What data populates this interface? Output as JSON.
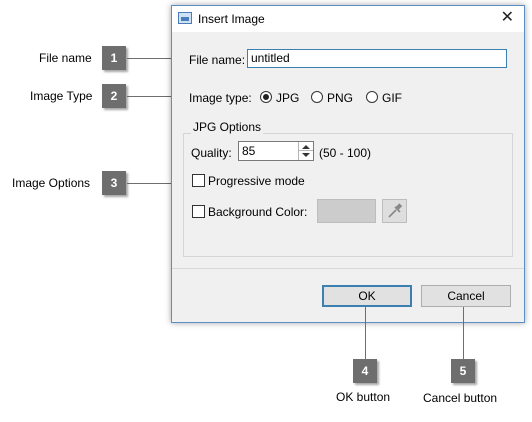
{
  "dialog": {
    "title": "Insert Image",
    "file_name_label": "File name:",
    "file_name_value": "untitled",
    "image_type_label": "Image type:",
    "image_types": [
      {
        "label": "JPG",
        "checked": true
      },
      {
        "label": "PNG",
        "checked": false
      },
      {
        "label": "GIF",
        "checked": false
      }
    ],
    "jpg_options_title": "JPG Options",
    "quality_label": "Quality:",
    "quality_value": "85",
    "quality_range": "(50 - 100)",
    "progressive_label": "Progressive mode",
    "progressive_checked": false,
    "background_color_label": "Background Color:",
    "background_color_checked": false,
    "background_color_value": "#cccccc",
    "ok_label": "OK",
    "cancel_label": "Cancel"
  },
  "callouts": [
    {
      "number": "1",
      "label": "File name"
    },
    {
      "number": "2",
      "label": "Image Type"
    },
    {
      "number": "3",
      "label": "Image Options"
    },
    {
      "number": "4",
      "label": "OK button"
    },
    {
      "number": "5",
      "label": "Cancel button"
    }
  ],
  "colors": {
    "marker": "#6e6e6e",
    "dialog_border": "#5a8ec8",
    "focus_border": "#3c7fb1",
    "dialog_background": "#f0f0f0"
  },
  "icons": [
    "app-icon",
    "close-icon",
    "eyedropper-icon",
    "spin-up-icon",
    "spin-down-icon"
  ]
}
